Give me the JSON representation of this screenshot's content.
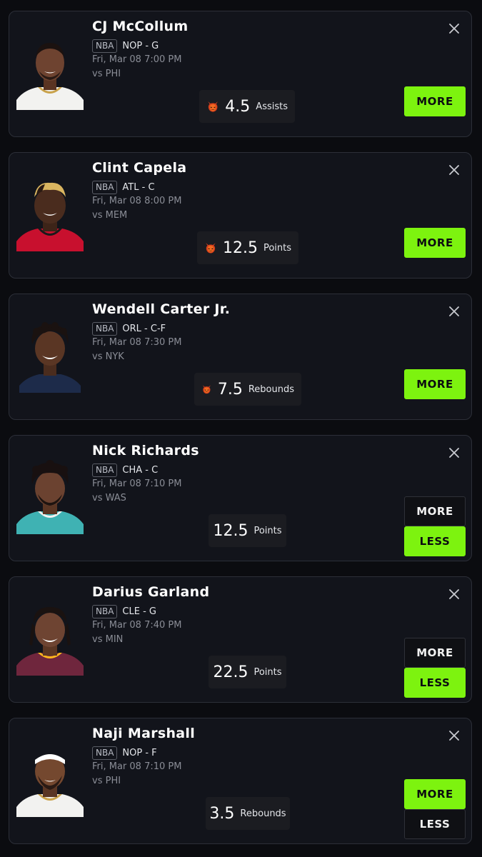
{
  "colors": {
    "accent_green": "#7df30f",
    "card_bg": "#12141b",
    "page_bg": "#0b0c10"
  },
  "icons": {
    "close": "close-icon",
    "demon": "demon-icon"
  },
  "cards": [
    {
      "name": "CJ McCollum",
      "league": "NBA",
      "team_pos": "NOP - G",
      "datetime": "Fri, Mar 08 7:00 PM",
      "opponent": "vs PHI",
      "line": "4.5",
      "stat": "Assists",
      "demon": true,
      "more_label": "MORE"
    },
    {
      "name": "Clint Capela",
      "league": "NBA",
      "team_pos": "ATL - C",
      "datetime": "Fri, Mar 08 8:00 PM",
      "opponent": "vs MEM",
      "line": "12.5",
      "stat": "Points",
      "demon": true,
      "more_label": "MORE"
    },
    {
      "name": "Wendell Carter Jr.",
      "league": "NBA",
      "team_pos": "ORL - C-F",
      "datetime": "Fri, Mar 08 7:30 PM",
      "opponent": "vs NYK",
      "line": "7.5",
      "stat": "Rebounds",
      "demon": true,
      "more_label": "MORE"
    },
    {
      "name": "Nick Richards",
      "league": "NBA",
      "team_pos": "CHA - C",
      "datetime": "Fri, Mar 08 7:10 PM",
      "opponent": "vs WAS",
      "line": "12.5",
      "stat": "Points",
      "demon": false,
      "more_label": "MORE",
      "less_label": "LESS",
      "selected": "less"
    },
    {
      "name": "Darius Garland",
      "league": "NBA",
      "team_pos": "CLE - G",
      "datetime": "Fri, Mar 08 7:40 PM",
      "opponent": "vs MIN",
      "line": "22.5",
      "stat": "Points",
      "demon": false,
      "more_label": "MORE",
      "less_label": "LESS",
      "selected": "less"
    },
    {
      "name": "Naji Marshall",
      "league": "NBA",
      "team_pos": "NOP - F",
      "datetime": "Fri, Mar 08 7:10 PM",
      "opponent": "vs PHI",
      "line": "3.5",
      "stat": "Rebounds",
      "demon": false,
      "more_label": "MORE",
      "less_label": "LESS",
      "selected": "more"
    }
  ]
}
